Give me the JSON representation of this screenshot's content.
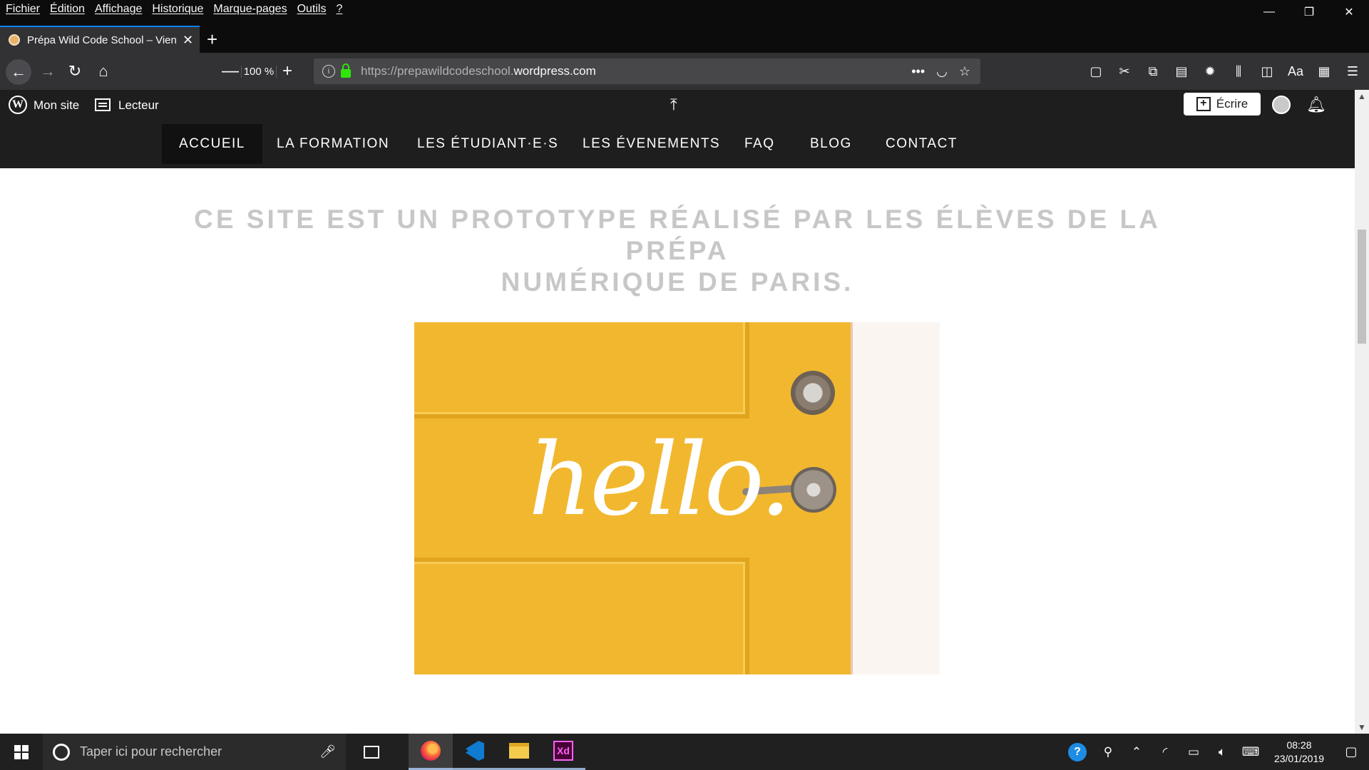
{
  "menubar": {
    "items": [
      "Fichier",
      "Édition",
      "Affichage",
      "Historique",
      "Marque-pages",
      "Outils",
      "?"
    ]
  },
  "window_controls": {
    "minimize": "—",
    "restore": "❐",
    "close": "✕"
  },
  "tab": {
    "title": "Prépa Wild Code School – Vien",
    "close": "✕",
    "new_tab": "+"
  },
  "toolbar": {
    "zoom_out": "—",
    "zoom_level": "100 %",
    "zoom_in": "+",
    "url_prefix": "https://prepawildcodeschool.",
    "url_domain": "wordpress.com",
    "info": "i"
  },
  "wpbar": {
    "logo": "W",
    "my_site": "Mon site",
    "reader": "Lecteur",
    "write": "Écrire"
  },
  "site_nav": {
    "items": [
      "ACCUEIL",
      "LA FORMATION",
      "LES ÉTUDIANT·E·S",
      "LES ÉVENEMENTS",
      "FAQ",
      "BLOG",
      "CONTACT"
    ],
    "active": "ACCUEIL"
  },
  "page": {
    "tagline_line1": "CE SITE EST UN PROTOTYPE RÉALISÉ PAR LES ÉLÈVES DE LA PRÉPA",
    "tagline_line2": "NUMÉRIQUE DE PARIS."
  },
  "hero": {
    "text": "hello.",
    "colors": {
      "door": "#f1b82f",
      "trim": "#e2a41e",
      "frame": "#fbf5f2"
    }
  },
  "taskbar": {
    "search_placeholder": "Taper ici pour rechercher",
    "xd_label": "Xd",
    "time": "08:28",
    "date": "23/01/2019",
    "help": "?"
  },
  "colors": {
    "browser_chrome": "#323234",
    "accent": "#0a84ff",
    "wp_bar": "#1e1e1e"
  }
}
